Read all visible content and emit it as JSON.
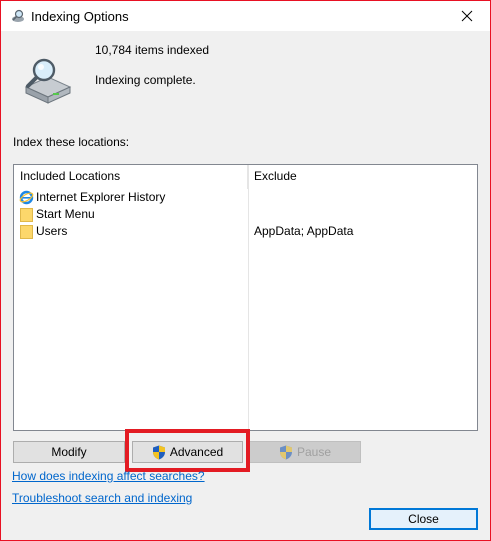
{
  "window": {
    "title": "Indexing Options",
    "accent_color": "#e81123"
  },
  "status": {
    "items_indexed": "10,784 items indexed",
    "state": "Indexing complete."
  },
  "locations": {
    "section_label": "Index these locations:",
    "columns": {
      "included": "Included Locations",
      "exclude": "Exclude"
    },
    "rows": [
      {
        "name": "Internet Explorer History",
        "exclude": "",
        "icon": "internet-explorer-icon"
      },
      {
        "name": "Start Menu",
        "exclude": "",
        "icon": "folder-icon"
      },
      {
        "name": "Users",
        "exclude": "AppData; AppData",
        "icon": "folder-icon"
      }
    ]
  },
  "buttons": {
    "modify": "Modify",
    "advanced": "Advanced",
    "pause": "Pause",
    "close": "Close"
  },
  "links": {
    "how_indexing": "How does indexing affect searches?",
    "troubleshoot": "Troubleshoot search and indexing"
  },
  "annotation": {
    "highlight_color": "#e31b23",
    "highlights": "advanced-button"
  }
}
